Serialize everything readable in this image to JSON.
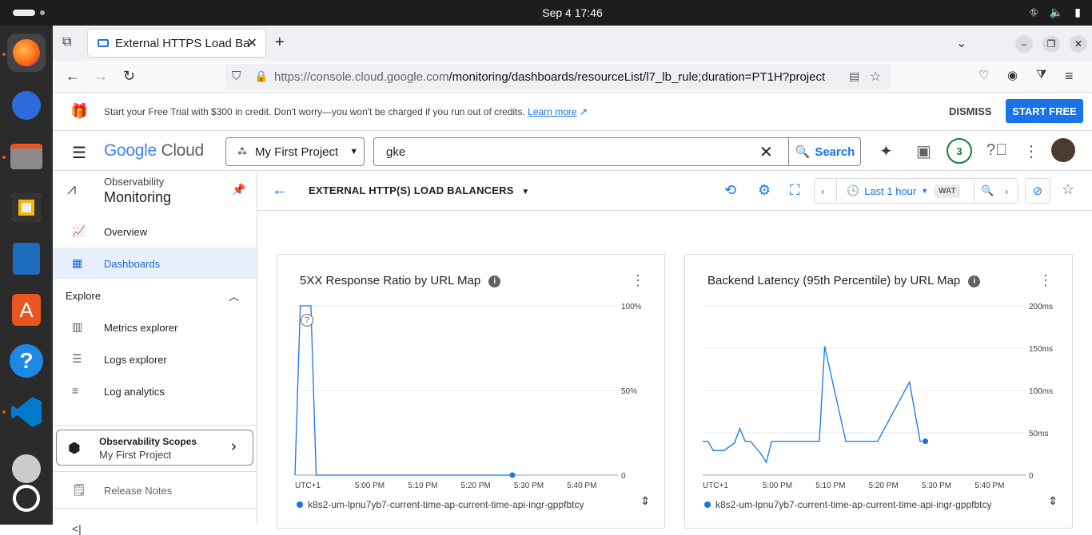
{
  "system": {
    "clock": "Sep 4  17:46"
  },
  "browser": {
    "tab_title": "External HTTPS Load Balancers",
    "url_domain": "https://console.cloud.google.com",
    "url_path": "/monitoring/dashboards/resourceList/l7_lb_rule;duration=PT1H?project"
  },
  "promo": {
    "text": "Start your Free Trial with $300 in credit. Don't worry—you won't be charged if you run out of credits.",
    "link": "Learn more",
    "dismiss": "DISMISS",
    "start": "START FREE"
  },
  "header": {
    "logo_google": "Google",
    "logo_cloud": "Cloud",
    "project": "My First Project",
    "search_value": "gke",
    "search_button": "Search",
    "notifications": "3"
  },
  "sidebar": {
    "section_small": "Observability",
    "section_title": "Monitoring",
    "items": [
      {
        "label": "Overview"
      },
      {
        "label": "Dashboards"
      },
      {
        "label": "Explore"
      },
      {
        "label": "Metrics explorer"
      },
      {
        "label": "Logs explorer"
      },
      {
        "label": "Log analytics"
      }
    ],
    "scopes_title": "Observability Scopes",
    "scopes_project": "My First Project",
    "release_notes": "Release Notes",
    "collapse": "<|"
  },
  "toolbar": {
    "title": "EXTERNAL HTTP(S) LOAD BALANCERS",
    "time_range": "Last 1 hour",
    "timezone": "WAT"
  },
  "charts": [
    {
      "title": "5XX Response Ratio by URL Map",
      "legend": "k8s2-um-lpnu7yb7-current-time-ap-current-time-api-ingr-gppfbtcy"
    },
    {
      "title": "Backend Latency (95th Percentile) by URL Map",
      "legend": "k8s2-um-lpnu7yb7-current-time-ap-current-time-api-ingr-gppfbtcy"
    }
  ],
  "chart_data": [
    {
      "type": "line",
      "title": "5XX Response Ratio by URL Map",
      "x_tick_labels": [
        "UTC+1",
        "5:00 PM",
        "5:10 PM",
        "5:20 PM",
        "5:30 PM",
        "5:40 PM"
      ],
      "y_tick_labels": [
        "0",
        "50%",
        "100%"
      ],
      "ylim": [
        0,
        100
      ],
      "y_axis_side": "right",
      "series": [
        {
          "name": "k8s2-um-lpnu7yb7-current-time-ap-current-time-api-ingr-gppfbtcy",
          "points": [
            [
              "16:46",
              0
            ],
            [
              "16:47",
              100
            ],
            [
              "16:49",
              100
            ],
            [
              "16:50",
              0
            ],
            [
              "17:27",
              0
            ]
          ]
        }
      ]
    },
    {
      "type": "line",
      "title": "Backend Latency (95th Percentile) by URL Map",
      "x_tick_labels": [
        "UTC+1",
        "5:00 PM",
        "5:10 PM",
        "5:20 PM",
        "5:30 PM",
        "5:40 PM"
      ],
      "y_tick_labels": [
        "0",
        "50ms",
        "100ms",
        "150ms",
        "200ms"
      ],
      "ylim": [
        0,
        200
      ],
      "y_axis_side": "right",
      "series": [
        {
          "name": "k8s2-um-lpnu7yb7-current-time-ap-current-time-api-ingr-gppfbtcy",
          "points": [
            [
              "16:46",
              40
            ],
            [
              "16:47",
              40
            ],
            [
              "16:48",
              29
            ],
            [
              "16:50",
              29
            ],
            [
              "16:52",
              38
            ],
            [
              "16:53",
              55
            ],
            [
              "16:54",
              40
            ],
            [
              "16:55",
              40
            ],
            [
              "16:57",
              25
            ],
            [
              "16:58",
              15
            ],
            [
              "16:59",
              40
            ],
            [
              "17:08",
              40
            ],
            [
              "17:09",
              152
            ],
            [
              "17:13",
              40
            ],
            [
              "17:19",
              40
            ],
            [
              "17:25",
              110
            ],
            [
              "17:27",
              40
            ],
            [
              "17:28",
              40
            ]
          ]
        }
      ]
    }
  ]
}
